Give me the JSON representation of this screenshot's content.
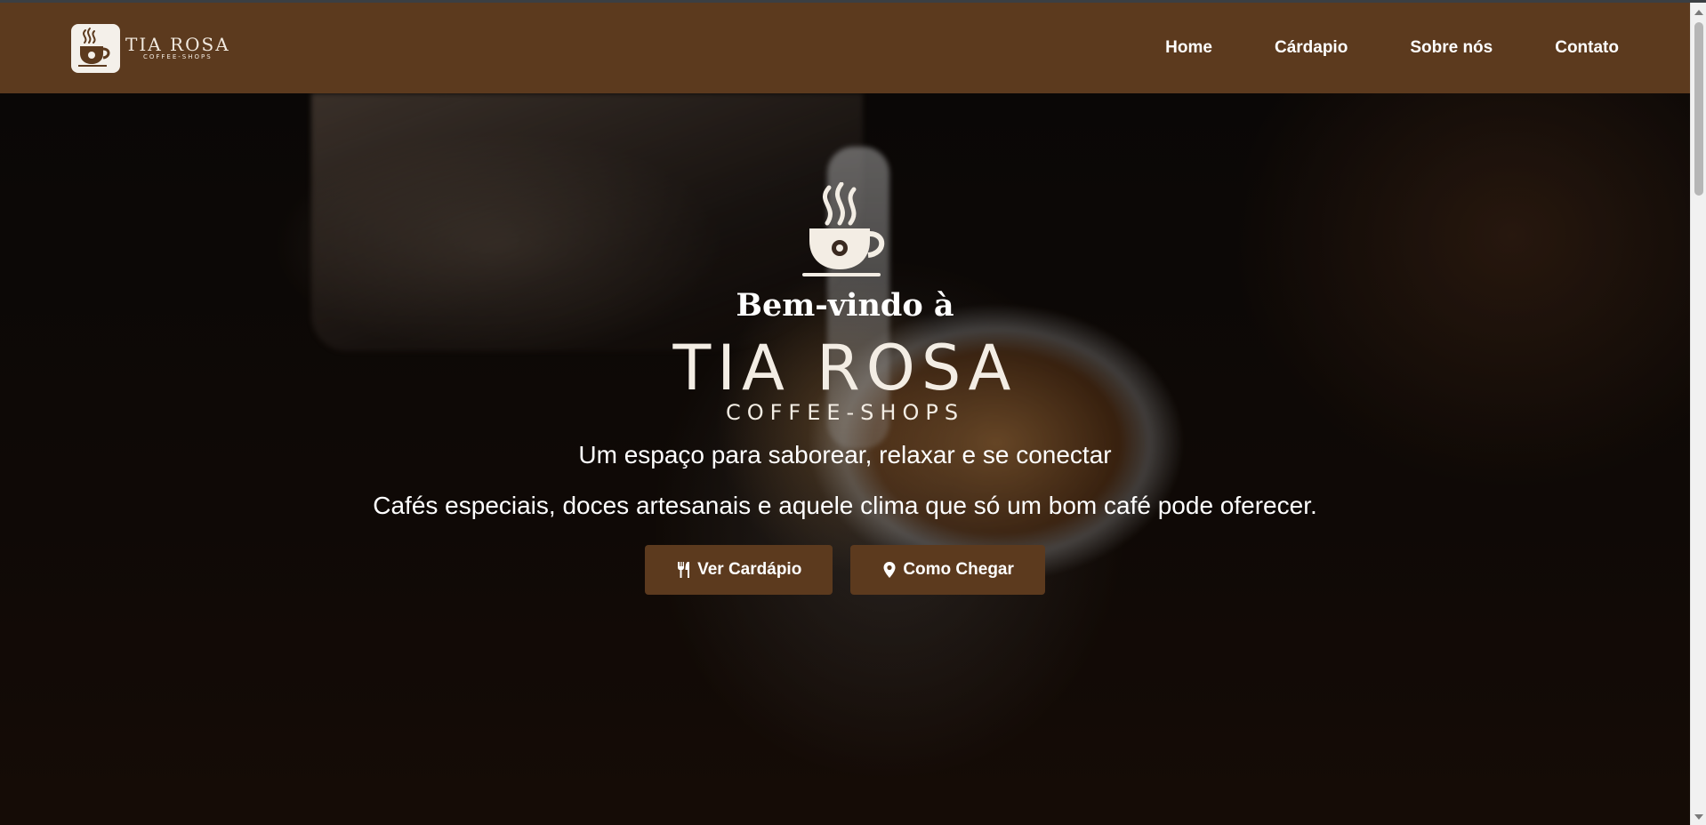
{
  "nav": {
    "brand": {
      "name": "TIA ROSA",
      "sub": "COFFEE-SHOPS",
      "logo_icon": "coffee-cup-rose-icon"
    },
    "links": [
      {
        "label": "Home"
      },
      {
        "label": "Cárdapio"
      },
      {
        "label": "Sobre nós"
      },
      {
        "label": "Contato"
      }
    ]
  },
  "hero": {
    "icon": "coffee-cup-rose-icon",
    "welcome": "Bem-vindo à",
    "brand_name": "TIA ROSA",
    "brand_sub": "COFFEE-SHOPS",
    "tagline": "Um espaço para saborear, relaxar e se conectar",
    "description": "Cafés especiais, doces artesanais e aquele clima que só um bom café pode oferecer.",
    "buttons": [
      {
        "label": "Ver Cardápio",
        "icon": "utensils-icon"
      },
      {
        "label": "Como Chegar",
        "icon": "map-pin-icon"
      }
    ]
  },
  "colors": {
    "nav_bg": "#5c3a1e",
    "button_bg": "#5c3a1e",
    "text_light": "#ffffff",
    "brand_text": "#f3ede4"
  }
}
